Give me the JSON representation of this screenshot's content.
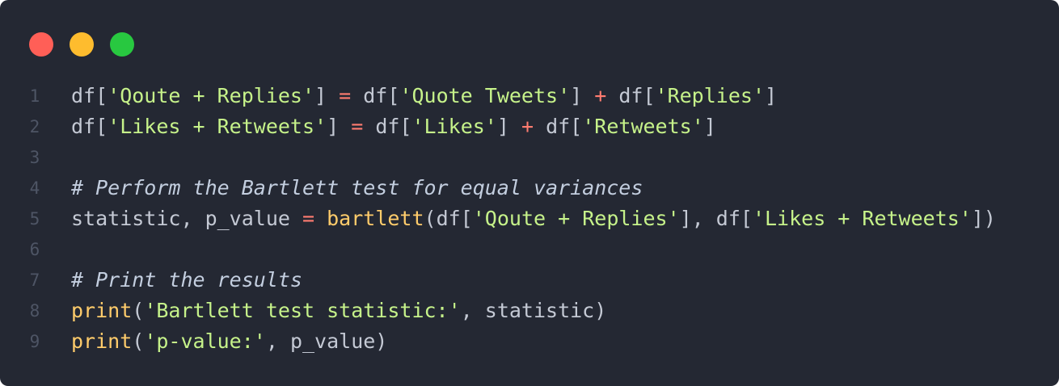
{
  "window": {
    "background": "#242833",
    "traffic_lights": [
      {
        "name": "close",
        "color": "#ff5f57"
      },
      {
        "name": "minimize",
        "color": "#febc2e"
      },
      {
        "name": "maximize",
        "color": "#28c840"
      }
    ]
  },
  "code": {
    "lines": [
      {
        "number": "1",
        "tokens": [
          {
            "t": "df[",
            "k": "plain"
          },
          {
            "t": "'Qoute + Replies'",
            "k": "str"
          },
          {
            "t": "] ",
            "k": "plain"
          },
          {
            "t": "=",
            "k": "op"
          },
          {
            "t": " df[",
            "k": "plain"
          },
          {
            "t": "'Quote Tweets'",
            "k": "str"
          },
          {
            "t": "] ",
            "k": "plain"
          },
          {
            "t": "+",
            "k": "op"
          },
          {
            "t": " df[",
            "k": "plain"
          },
          {
            "t": "'Replies'",
            "k": "str"
          },
          {
            "t": "]",
            "k": "plain"
          }
        ]
      },
      {
        "number": "2",
        "tokens": [
          {
            "t": "df[",
            "k": "plain"
          },
          {
            "t": "'Likes + Retweets'",
            "k": "str"
          },
          {
            "t": "] ",
            "k": "plain"
          },
          {
            "t": "=",
            "k": "op"
          },
          {
            "t": " df[",
            "k": "plain"
          },
          {
            "t": "'Likes'",
            "k": "str"
          },
          {
            "t": "] ",
            "k": "plain"
          },
          {
            "t": "+",
            "k": "op"
          },
          {
            "t": " df[",
            "k": "plain"
          },
          {
            "t": "'Retweets'",
            "k": "str"
          },
          {
            "t": "]",
            "k": "plain"
          }
        ]
      },
      {
        "number": "3",
        "tokens": []
      },
      {
        "number": "4",
        "tokens": [
          {
            "t": "# Perform the Bartlett test for equal variances",
            "k": "comment"
          }
        ]
      },
      {
        "number": "5",
        "tokens": [
          {
            "t": "statistic, p_value ",
            "k": "plain"
          },
          {
            "t": "=",
            "k": "op"
          },
          {
            "t": " ",
            "k": "plain"
          },
          {
            "t": "bartlett",
            "k": "fn"
          },
          {
            "t": "(df[",
            "k": "plain"
          },
          {
            "t": "'Qoute + Replies'",
            "k": "str"
          },
          {
            "t": "], df[",
            "k": "plain"
          },
          {
            "t": "'Likes + Retweets'",
            "k": "str"
          },
          {
            "t": "])",
            "k": "plain"
          }
        ]
      },
      {
        "number": "6",
        "tokens": []
      },
      {
        "number": "7",
        "tokens": [
          {
            "t": "# Print the results",
            "k": "comment"
          }
        ]
      },
      {
        "number": "8",
        "tokens": [
          {
            "t": "print",
            "k": "fn"
          },
          {
            "t": "(",
            "k": "plain"
          },
          {
            "t": "'Bartlett test statistic:'",
            "k": "str"
          },
          {
            "t": ", statistic)",
            "k": "plain"
          }
        ]
      },
      {
        "number": "9",
        "tokens": [
          {
            "t": "print",
            "k": "fn"
          },
          {
            "t": "(",
            "k": "plain"
          },
          {
            "t": "'p-value:'",
            "k": "str"
          },
          {
            "t": ", p_value)",
            "k": "plain"
          }
        ]
      }
    ]
  }
}
